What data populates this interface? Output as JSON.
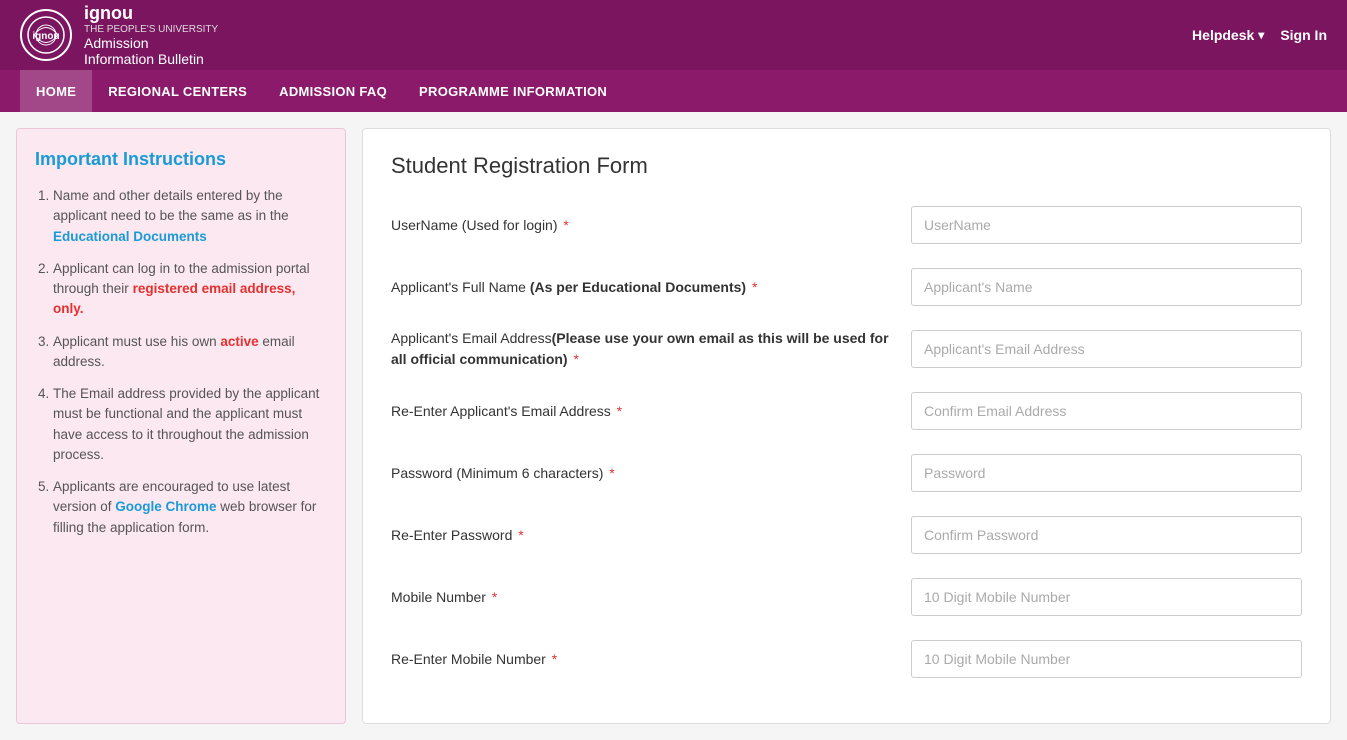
{
  "header": {
    "logo_alt": "IGNOU Logo",
    "university_name": "ignou",
    "university_tagline": "THE PEOPLE'S UNIVERSITY",
    "title_main": "Admission",
    "title_sub": "Information Bulletin",
    "helpdesk_label": "Helpdesk",
    "signin_label": "Sign In"
  },
  "navbar": {
    "items": [
      {
        "label": "HOME",
        "href": "#"
      },
      {
        "label": "REGIONAL CENTERS",
        "href": "#"
      },
      {
        "label": "ADMISSION FAQ",
        "href": "#"
      },
      {
        "label": "PROGRAMME INFORMATION",
        "href": "#"
      }
    ]
  },
  "sidebar": {
    "title": "Important Instructions",
    "instructions": [
      {
        "text_before": "Name and other details entered by the applicant need to be the same as in the ",
        "link_text": "Educational Documents",
        "text_after": ""
      },
      {
        "text_before": "Applicant can log in to the admission portal through their ",
        "link_text": "registered email address, only.",
        "text_after": "",
        "link_class": "active-link"
      },
      {
        "text_before": "Applicant must use his own ",
        "link_text": "active",
        "text_after": " email address.",
        "link_class": "active-link"
      },
      {
        "text_before": "The Email address provided by the applicant must be functional and the applicant must have access to it throughout the admission process.",
        "link_text": "",
        "text_after": ""
      },
      {
        "text_before": "Applicants are encouraged to use latest version of ",
        "link_text": "Google Chrome",
        "text_after": " web browser for filling the application form.",
        "link_class": "google-link"
      }
    ]
  },
  "form": {
    "title": "Student Registration Form",
    "fields": [
      {
        "label": "UserName (Used for login)",
        "required": true,
        "bold_part": "",
        "placeholder": "UserName",
        "type": "text",
        "name": "username"
      },
      {
        "label": "Applicant's Full Name ",
        "label_bold": "(As per Educational Documents)",
        "required": true,
        "placeholder": "Applicant's Name",
        "type": "text",
        "name": "applicant_name"
      },
      {
        "label": "Applicant's Email Address",
        "label_bold": "(Please use your own email as this will be used for all official communication)",
        "required": true,
        "placeholder": "Applicant's Email Address",
        "type": "email",
        "name": "applicant_email"
      },
      {
        "label": "Re-Enter Applicant's Email Address",
        "required": true,
        "placeholder": "Confirm Email Address",
        "type": "email",
        "name": "confirm_email"
      },
      {
        "label": "Password (Minimum 6 characters)",
        "required": true,
        "placeholder": "Password",
        "type": "password",
        "name": "password"
      },
      {
        "label": "Re-Enter Password",
        "required": true,
        "placeholder": "Confirm Password",
        "type": "password",
        "name": "confirm_password"
      },
      {
        "label": "Mobile Number",
        "required": true,
        "placeholder": "10 Digit Mobile Number",
        "type": "tel",
        "name": "mobile"
      },
      {
        "label": "Re-Enter Mobile Number",
        "required": true,
        "placeholder": "10 Digit Mobile Number",
        "type": "tel",
        "name": "confirm_mobile"
      }
    ]
  }
}
